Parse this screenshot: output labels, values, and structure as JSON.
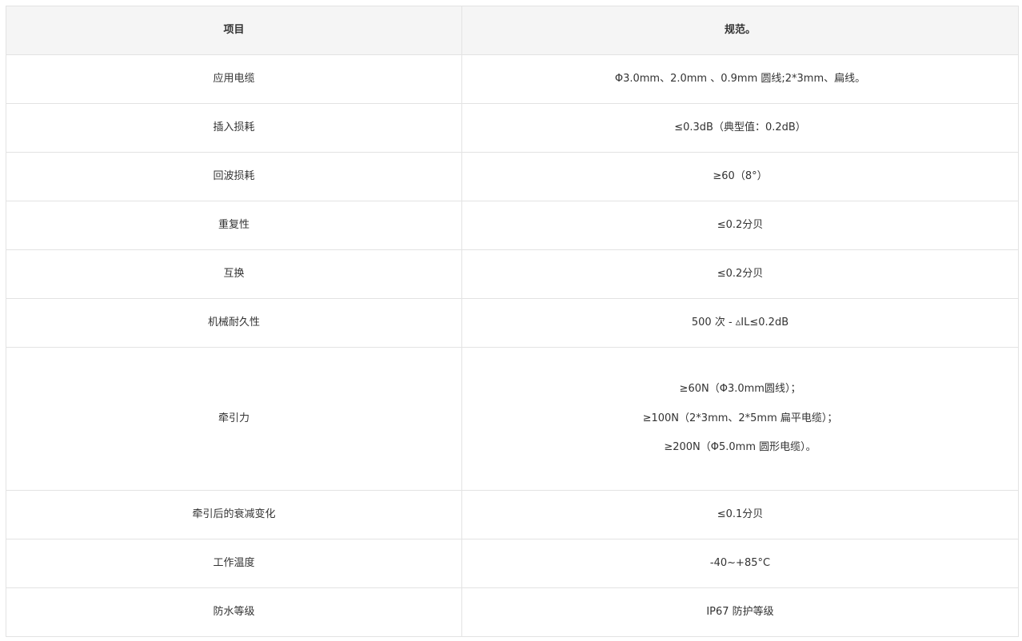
{
  "table": {
    "headers": {
      "item": "项目",
      "spec": "规范。"
    },
    "rows": [
      {
        "item": "应用电缆",
        "spec": "Φ3.0mm、2.0mm 、0.9mm 圆线;2*3mm、扁线。"
      },
      {
        "item": "插入损耗",
        "spec": "≤0.3dB（典型值：0.2dB）"
      },
      {
        "item": "回波损耗",
        "spec": "≥60（8°）"
      },
      {
        "item": "重复性",
        "spec": "≤0.2分贝"
      },
      {
        "item": "互换",
        "spec": "≤0.2分贝"
      },
      {
        "item": "机械耐久性",
        "spec": "500 次 - ▵IL≤0.2dB"
      },
      {
        "item": "牵引力",
        "spec_lines": [
          "≥60N（Φ3.0mm圆线）；",
          "≥100N（2*3mm、2*5mm 扁平电缆）；",
          "≥200N（Φ5.0mm 圆形电缆）。"
        ]
      },
      {
        "item": "牵引后的衰减变化",
        "spec": "≤0.1分贝"
      },
      {
        "item": "工作温度",
        "spec": "-40~+85°C"
      },
      {
        "item": "防水等级",
        "spec": "IP67 防护等级"
      }
    ]
  }
}
